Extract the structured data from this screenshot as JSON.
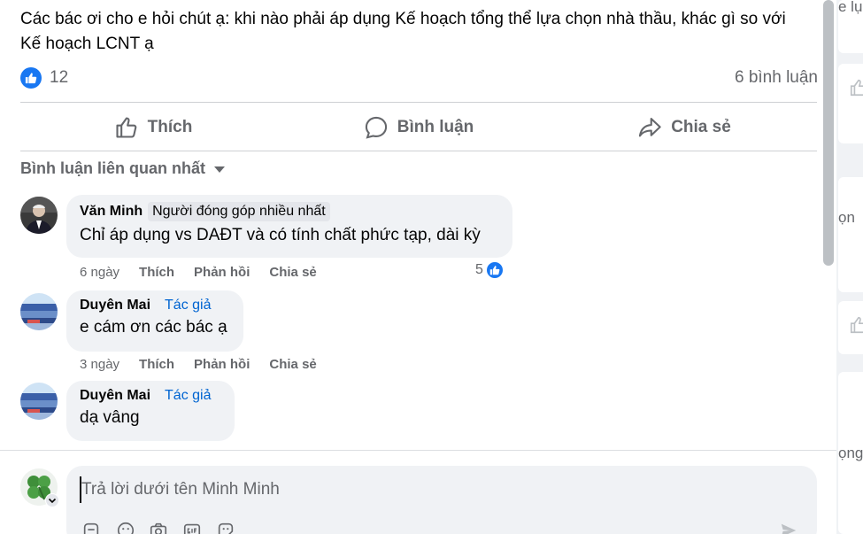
{
  "post": {
    "text": "Các bác ơi cho e hỏi chút ạ: khi nào phải áp dụng Kế hoạch tổng thể lựa chọn nhà thầu, khác gì so với Kế hoạch LCNT ạ",
    "reaction_count": "12",
    "comment_count": "6 bình luận"
  },
  "actions": {
    "like": "Thích",
    "comment": "Bình luận",
    "share": "Chia sẻ"
  },
  "sort_label": "Bình luận liên quan nhất",
  "comments": [
    {
      "author": "Văn Minh",
      "badge": "Người đóng góp nhiều nhất",
      "text": "Chỉ áp dụng vs DAĐT và có tính chất phức tạp, dài kỳ",
      "time": "6 ngày",
      "like": "Thích",
      "reply": "Phản hồi",
      "share": "Chia sẻ",
      "reactions": "5"
    },
    {
      "author": "Duyên Mai",
      "tag": "Tác giả",
      "text": "e cám ơn các bác ạ",
      "time": "3 ngày",
      "like": "Thích",
      "reply": "Phản hồi",
      "share": "Chia sẻ"
    },
    {
      "author": "Duyên Mai",
      "tag": "Tác giả",
      "text": "dạ vâng"
    }
  ],
  "composer": {
    "placeholder": "Trả lời dưới tên Minh Minh"
  },
  "background_fragments": [
    "e lụ",
    "ọn",
    "ọng"
  ],
  "colors": {
    "accent": "#1877f2",
    "author_tag": "#0064d1",
    "bubble": "#f0f2f5",
    "muted_text": "#65676b"
  }
}
